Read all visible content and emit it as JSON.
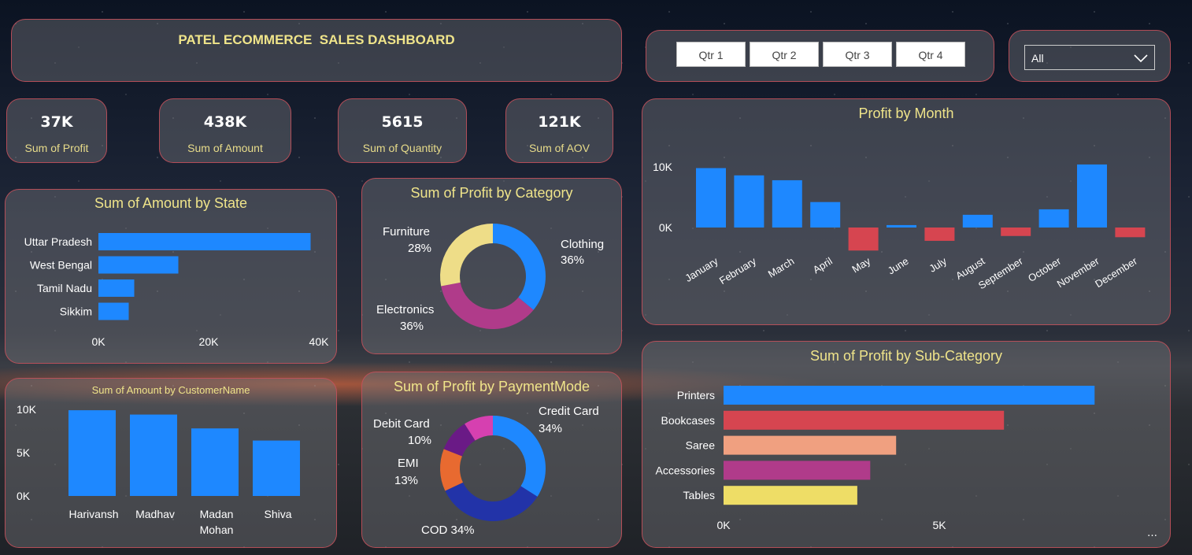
{
  "header": {
    "title": "PATEL ECOMMERCE  SALES DASHBOARD"
  },
  "slicer": {
    "quarters": [
      "Qtr 1",
      "Qtr 2",
      "Qtr 3",
      "Qtr 4"
    ],
    "dropdown_value": "All"
  },
  "kpis": [
    {
      "value": "37K",
      "label": "Sum of Profit"
    },
    {
      "value": "438K",
      "label": "Sum of Amount"
    },
    {
      "value": "5615",
      "label": "Sum of Quantity"
    },
    {
      "value": "121K",
      "label": "Sum of AOV"
    }
  ],
  "colors": {
    "accent": "#1e88ff",
    "negative": "#d64550",
    "title": "#efe48a",
    "border": "#c8505a"
  },
  "chart_data": [
    {
      "type": "bar",
      "orientation": "horizontal",
      "title": "Sum of Amount by State",
      "categories": [
        "Uttar Pradesh",
        "West Bengal",
        "Tamil Nadu",
        "Sikkim"
      ],
      "values": [
        38500,
        14500,
        6500,
        5500
      ],
      "xlim": [
        0,
        40000
      ],
      "xticks": [
        "0K",
        "20K",
        "40K"
      ],
      "color": "#1e88ff"
    },
    {
      "type": "pie",
      "donut": true,
      "title": "Sum of Profit by Category",
      "labels": [
        "Clothing",
        "Electronics",
        "Furniture"
      ],
      "values": [
        36,
        36,
        28
      ],
      "percent_labels": [
        "36%",
        "36%",
        "28%"
      ],
      "colors": [
        "#1e88ff",
        "#b03b8a",
        "#eedd88"
      ]
    },
    {
      "type": "bar",
      "title": "Profit by Month",
      "categories": [
        "January",
        "February",
        "March",
        "April",
        "May",
        "June",
        "July",
        "August",
        "September",
        "October",
        "November",
        "December"
      ],
      "values": [
        9800,
        8600,
        7800,
        4200,
        -3800,
        400,
        -2200,
        2100,
        -1400,
        3000,
        10400,
        -1600
      ],
      "yticks": [
        "0K",
        "10K"
      ],
      "ylim": [
        -5000,
        10000
      ],
      "positive_color": "#1e88ff",
      "negative_color": "#d64550"
    },
    {
      "type": "bar",
      "title": "Sum of Amount by CustomerName",
      "categories": [
        "Harivansh",
        "Madhav",
        "Madan Mohan",
        "Shiva"
      ],
      "values": [
        9900,
        9400,
        7800,
        6400
      ],
      "yticks": [
        "0K",
        "5K",
        "10K"
      ],
      "ylim": [
        0,
        10000
      ],
      "color": "#1e88ff"
    },
    {
      "type": "pie",
      "donut": true,
      "title": "Sum of Profit by PaymentMode",
      "labels": [
        "Credit Card",
        "COD",
        "EMI",
        "Debit Card"
      ],
      "values": [
        34,
        34,
        13,
        10,
        9
      ],
      "display_labels": [
        {
          "name": "Credit Card",
          "pct": "34%"
        },
        {
          "name": "COD 34%",
          "pct": ""
        },
        {
          "name": "EMI",
          "pct": "13%"
        },
        {
          "name": "Debit Card",
          "pct": "10%"
        }
      ],
      "colors": [
        "#1e88ff",
        "#2233a8",
        "#e86a30",
        "#6a1a86",
        "#d640b0"
      ]
    },
    {
      "type": "bar",
      "orientation": "horizontal",
      "title": "Sum of Profit by Sub-Category",
      "categories": [
        "Printers",
        "Bookcases",
        "Saree",
        "Accessories",
        "Tables"
      ],
      "values": [
        8600,
        6500,
        4000,
        3400,
        3100
      ],
      "xlim": [
        0,
        10000
      ],
      "xticks": [
        "0K",
        "5K"
      ],
      "colors": [
        "#1e88ff",
        "#d64550",
        "#f0a080",
        "#b03b8a",
        "#eedd66"
      ]
    }
  ]
}
